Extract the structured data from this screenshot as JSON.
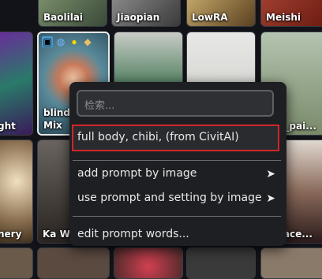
{
  "cards_top": [
    {
      "label": "Baolilai"
    },
    {
      "label": "Jiaopian"
    },
    {
      "label": "LowRA"
    },
    {
      "label": "Meishi"
    }
  ],
  "cards_mid": [
    {
      "label": "ght"
    },
    {
      "label_line1": "blindb",
      "label_line2": "Mix"
    },
    {
      "label": ""
    },
    {
      "label": ""
    },
    {
      "label": "ese_pai..."
    }
  ],
  "cards_low": [
    {
      "label": "nery"
    },
    {
      "label": "Ka Wa"
    },
    {
      "label": "edface..."
    }
  ],
  "toolbar_icons": [
    "image-icon",
    "globe-icon",
    "lightbulb-icon",
    "tag-icon"
  ],
  "menu": {
    "search_placeholder": "检索...",
    "highlighted_item": "full body, chibi, (from CivitAI)",
    "items": [
      {
        "label": "add prompt by image",
        "has_submenu": true
      },
      {
        "label": "use prompt and setting by image",
        "has_submenu": true
      }
    ],
    "edit_item": "edit prompt words...",
    "submenu_arrow": "➤"
  },
  "colors": {
    "highlight_border": "#d0262b",
    "menu_bg": "#1e1f22"
  }
}
